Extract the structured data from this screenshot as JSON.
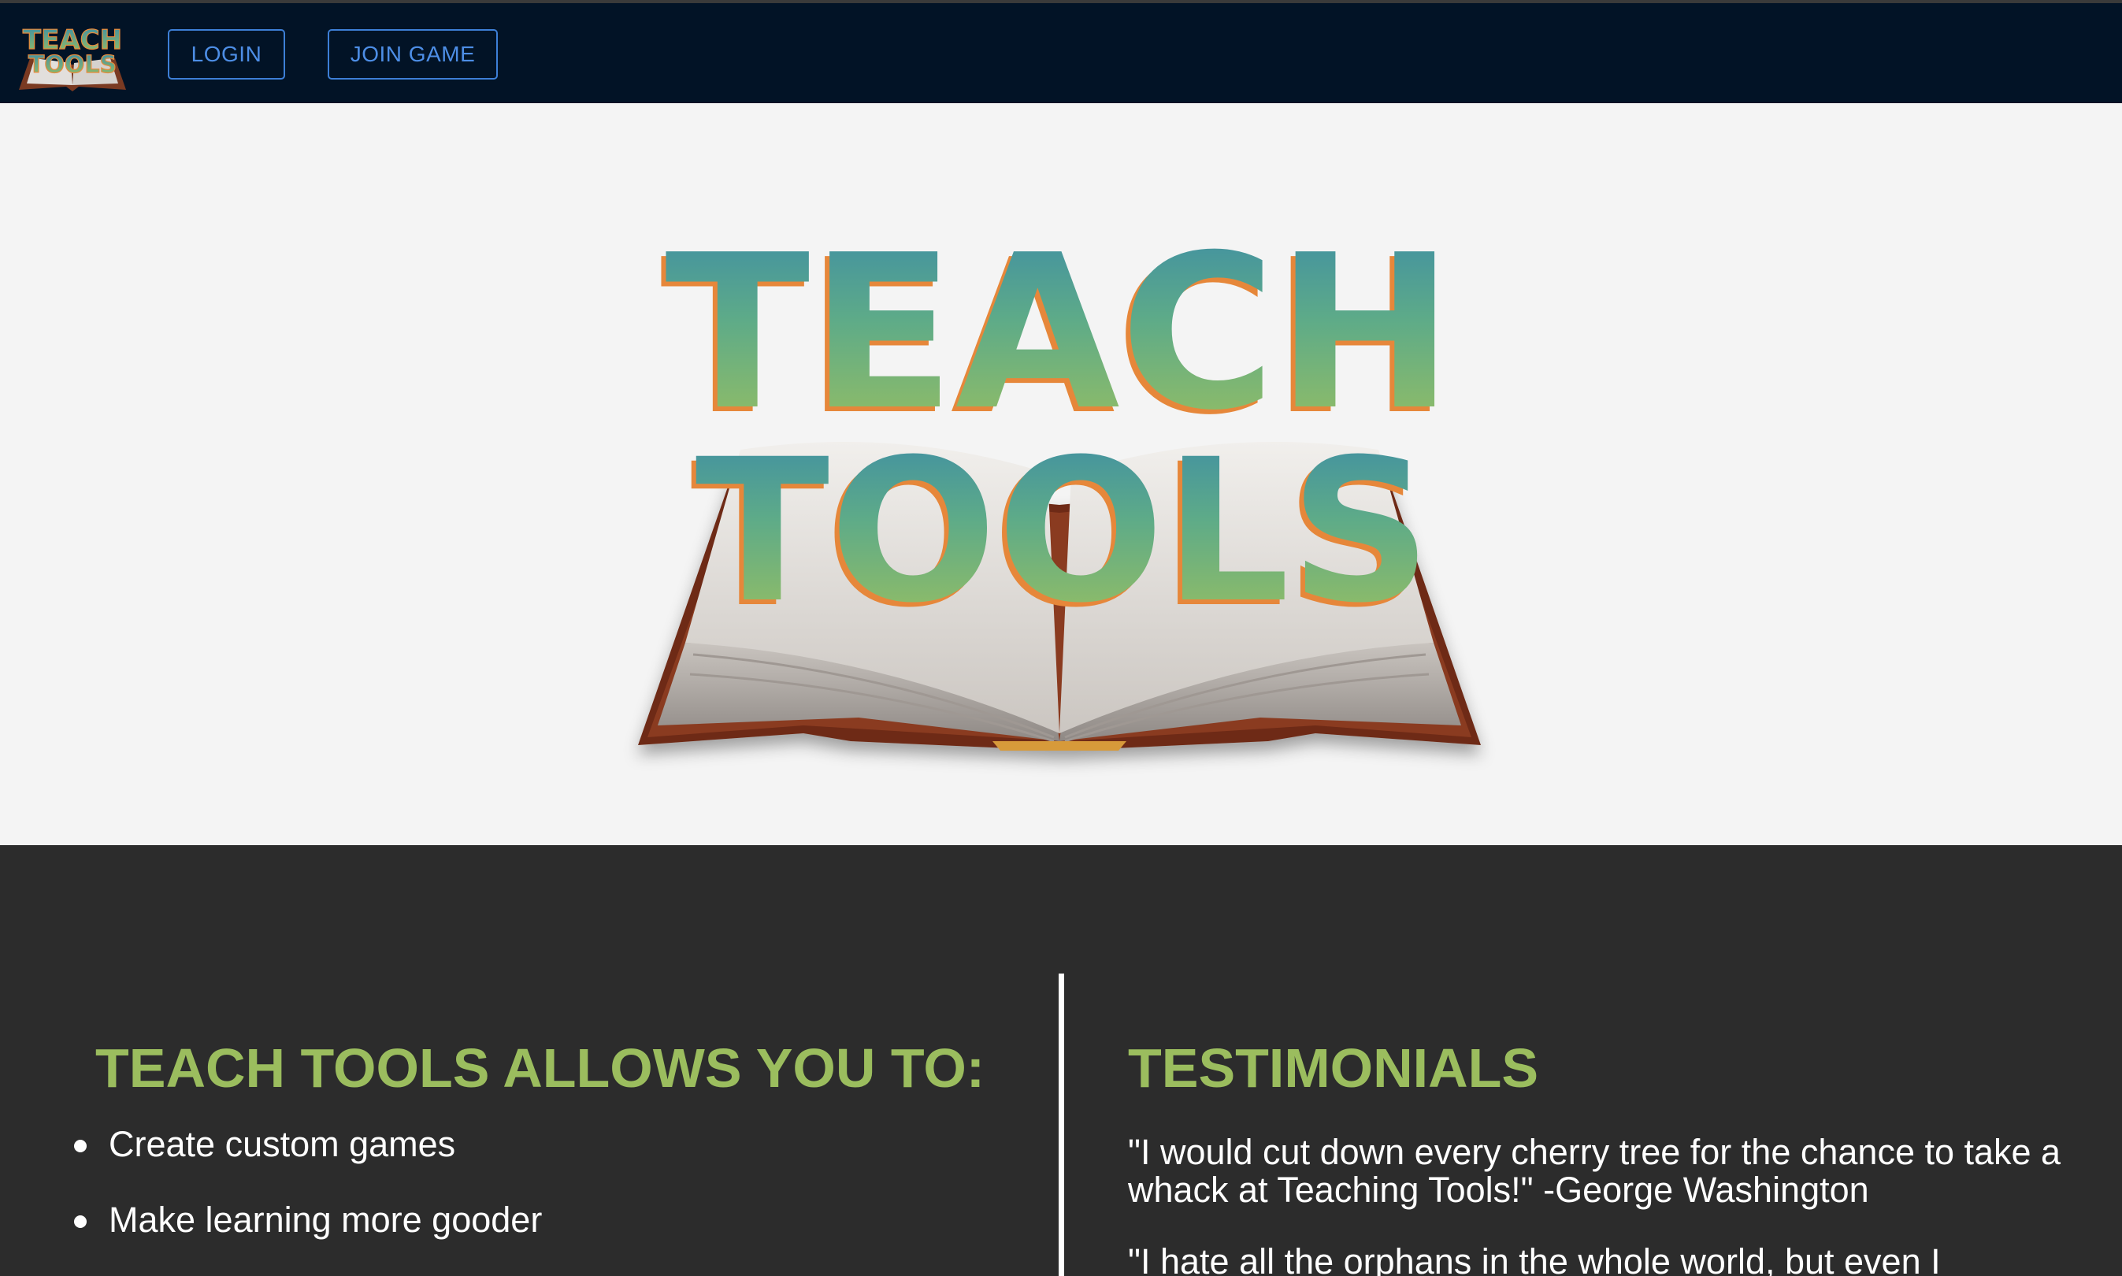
{
  "nav": {
    "logo_alt": "TEACH TOOLS",
    "login_label": "LOGIN",
    "join_label": "JOIN GAME"
  },
  "hero": {
    "logo_line1": "TEACH",
    "logo_line2": "TOOLS"
  },
  "features": {
    "heading": "TEACH TOOLS ALLOWS YOU TO:",
    "items": [
      "Create custom games",
      "Make learning more gooder"
    ]
  },
  "testimonials": {
    "heading": "TESTIMONIALS",
    "quotes": [
      "\"I would cut down every cherry tree for the chance to take a whack at Teaching Tools!\" -George Washington",
      "\"I hate all the orphans in the whole world, but even I"
    ]
  },
  "colors": {
    "nav_bg": "#021326",
    "hero_bg": "#f4f4f4",
    "section_bg": "#2c2c2c",
    "accent_green": "#9bbd5e",
    "button_blue": "#3d7fd6"
  }
}
